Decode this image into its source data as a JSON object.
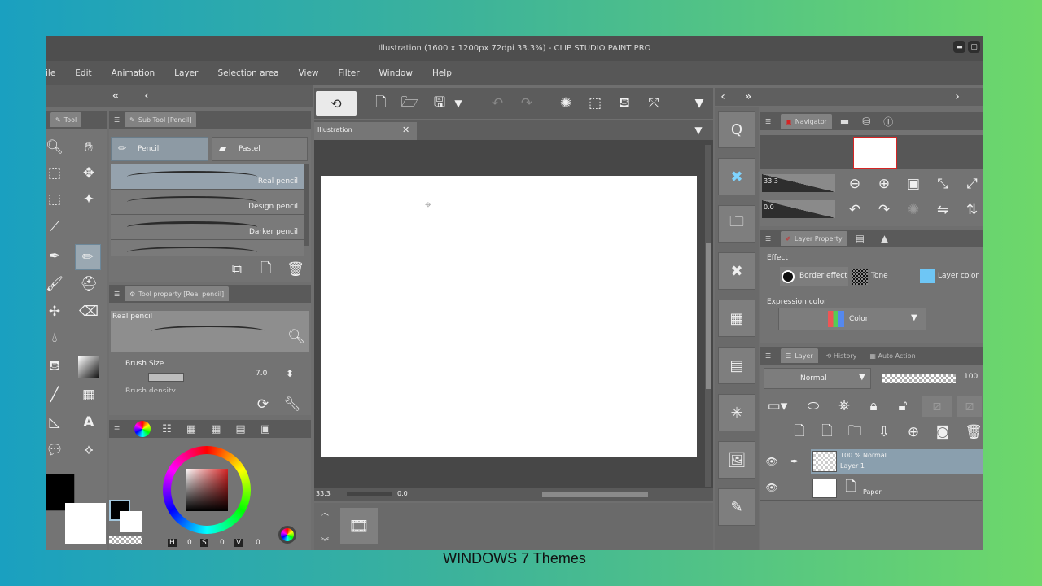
{
  "window": {
    "title": "Illustration (1600 x 1200px 72dpi 33.3%)  - CLIP STUDIO PAINT PRO"
  },
  "menu": [
    "ile",
    "Edit",
    "Animation",
    "Layer",
    "Selection area",
    "View",
    "Filter",
    "Window",
    "Help"
  ],
  "tool_panel": {
    "tab": "Tool"
  },
  "sub_tool": {
    "header": "Sub Tool [Pencil]",
    "tabs": [
      "Pencil",
      "Pastel"
    ],
    "brushes": [
      "Real pencil",
      "Design pencil",
      "Darker pencil"
    ]
  },
  "tool_property": {
    "header": "Tool property [Real pencil]",
    "preview_name": "Real pencil",
    "brush_size_label": "Brush Size",
    "brush_size_value": "7.0",
    "brush_density_label": "Brush density"
  },
  "color_panel": {
    "h_label": "H",
    "h_value": "0",
    "s_label": "S",
    "s_value": "0",
    "v_label": "V",
    "v_value": "0"
  },
  "canvas": {
    "tab_name": "Illustration",
    "zoom": "33.3",
    "rotation": "0.0"
  },
  "navigator": {
    "tab": "Navigator",
    "zoom": "33.3",
    "rotation": "0.0"
  },
  "layer_property": {
    "tab": "Layer Property",
    "effect_label": "Effect",
    "effects": [
      "Border effect",
      "Tone",
      "Layer color"
    ],
    "expression_label": "Expression color",
    "expression_value": "Color"
  },
  "layer_panel": {
    "tabs": [
      "Layer",
      "History",
      "Auto Action"
    ],
    "blend_mode": "Normal",
    "opacity": "100",
    "layers": [
      {
        "mode": "100 % Normal",
        "name": "Layer 1"
      },
      {
        "name": "Paper"
      }
    ]
  },
  "caption": "WINDOWS 7 Themes",
  "colors": {
    "accent_red": "#d52424",
    "window_bg": "#6f6f6f"
  }
}
